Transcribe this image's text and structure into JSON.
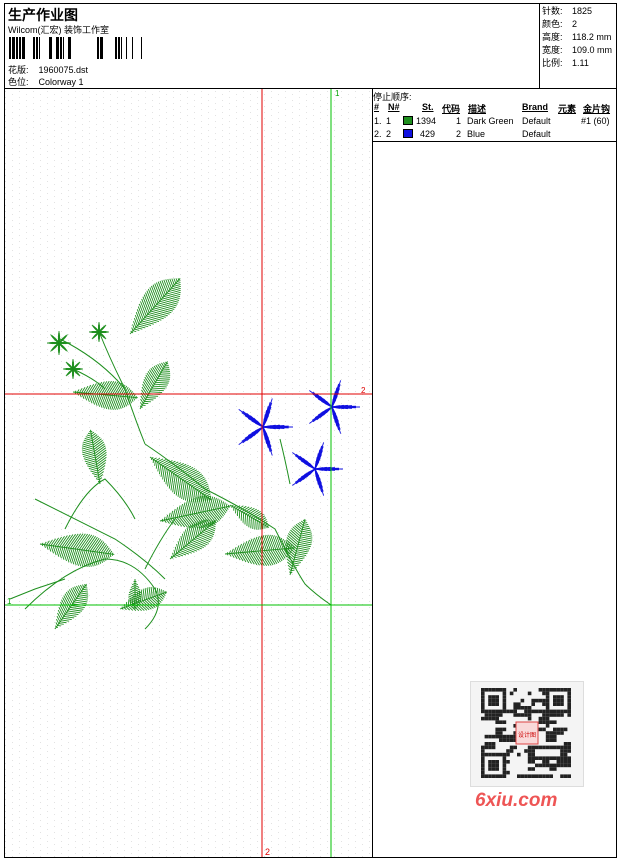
{
  "header": {
    "title": "生产作业图",
    "subtitle": "Wilcom(汇宏) 装饰工作室",
    "design_label": "花版:",
    "design_value": "1960075.dst",
    "colorway_label": "色位:",
    "colorway_value": "Colorway 1"
  },
  "stats": {
    "stitches_label": "针数:",
    "stitches_value": "1825",
    "colors_label": "颜色:",
    "colors_value": "2",
    "height_label": "高度:",
    "height_value": "118.2 mm",
    "width_label": "宽度:",
    "width_value": "109.0 mm",
    "scale_label": "比例:",
    "scale_value": "1.11"
  },
  "canvas": {
    "marker_1_label": "1",
    "marker_2_label": "2",
    "marker_1_top_label": "1",
    "marker_2_side_label": "2"
  },
  "sequence": {
    "title": "停止顺序:",
    "columns": [
      "#",
      "N#",
      "St.",
      "代码",
      "描述",
      "Brand",
      "元素",
      "金片钩"
    ],
    "rows": [
      {
        "idx": "1.",
        "n": "1",
        "color": "#1e8f1e",
        "st": "1394",
        "code": "1",
        "desc": "Dark Green",
        "brand": "Default",
        "extra": "#1 (60)"
      },
      {
        "idx": "2.",
        "n": "2",
        "color": "#1010e0",
        "st": "429",
        "code": "2",
        "desc": "Blue",
        "brand": "Default",
        "extra": ""
      }
    ]
  },
  "watermark": {
    "text": "6xiu.com",
    "qr_text": "设计图"
  },
  "colors": {
    "green_thread": "#1e8f1e",
    "blue_thread": "#1010e0",
    "guide_red": "#e00000",
    "guide_green": "#00c000"
  }
}
